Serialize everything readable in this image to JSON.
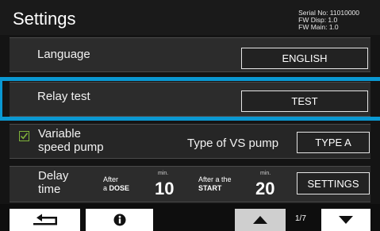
{
  "header": {
    "title": "Settings",
    "serial_no": "Serial No: 11010000",
    "fw_disp": "FW Disp: 1.0",
    "fw_main": "FW Main: 1.0"
  },
  "language": {
    "label": "Language",
    "button": "ENGLISH"
  },
  "relay": {
    "label": "Relay test",
    "button": "TEST"
  },
  "vs_pump": {
    "checkbox_label_line1": "Variable",
    "checkbox_label_line2": "speed pump",
    "checked": true,
    "type_label": "Type of VS pump",
    "type_button": "TYPE A"
  },
  "delay": {
    "label_line1": "Delay",
    "label_line2": "time",
    "after_dose_line1": "After",
    "after_dose_line2_prefix": "a",
    "after_dose_line2_bold": "DOSE",
    "dose_unit": "min.",
    "dose_value": "10",
    "after_start_line1": "After a the",
    "after_start_line2": "START",
    "start_unit": "min.",
    "start_value": "20",
    "settings_button": "SETTINGS"
  },
  "footer": {
    "back_icon": "return-arrow-icon",
    "info_icon": "info-icon",
    "up_icon": "arrow-up-icon",
    "down_icon": "arrow-down-icon",
    "page_indicator": "1/7"
  },
  "colors": {
    "highlight": "#0a98d2",
    "checkbox": "#7fb23a",
    "background": "#141414"
  }
}
